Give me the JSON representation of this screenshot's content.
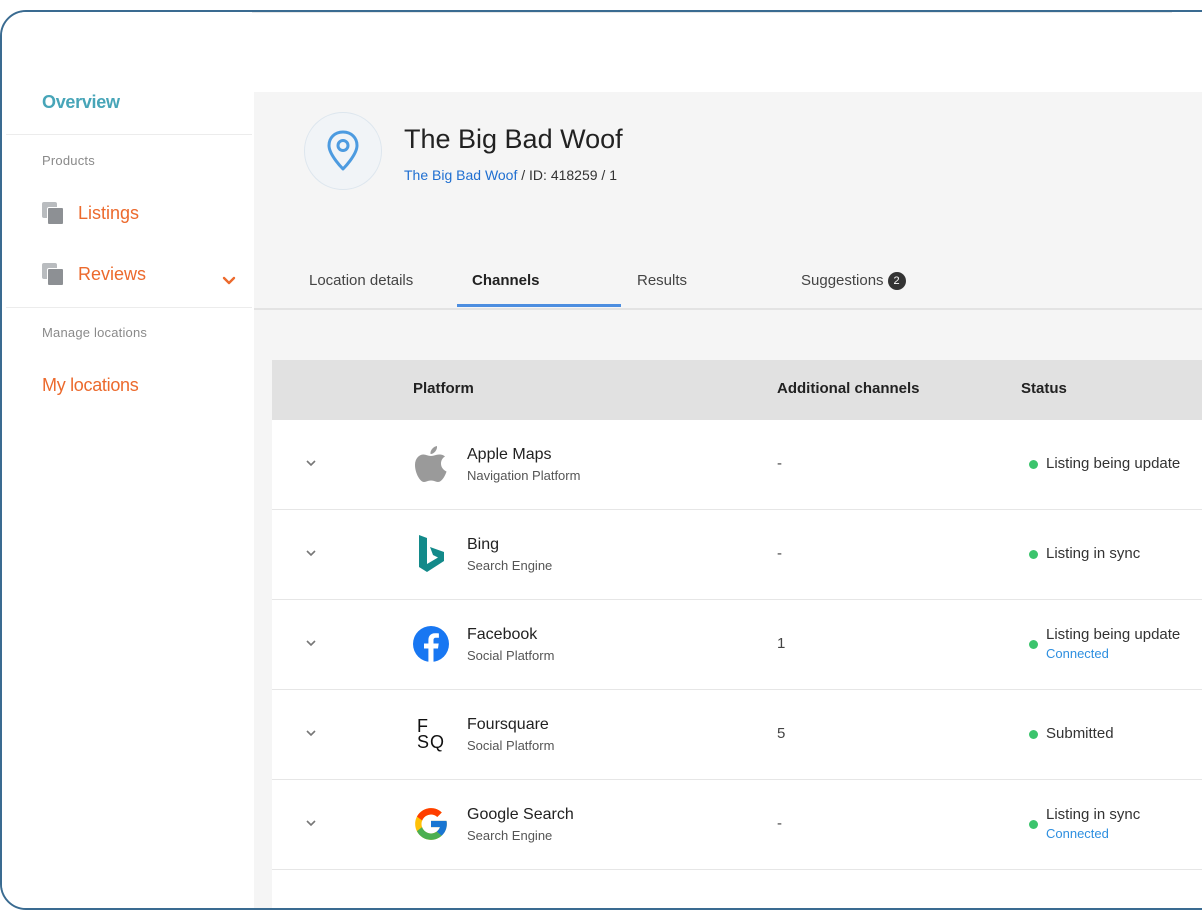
{
  "sidebar": {
    "overview": "Overview",
    "products_label": "Products",
    "listings": "Listings",
    "reviews": "Reviews",
    "manage_label": "Manage locations",
    "my_locations": "My locations"
  },
  "location": {
    "title": "The Big Bad Woof",
    "breadcrumb_link": "The Big Bad Woof",
    "breadcrumb_rest": " / ID: 418259 / 1"
  },
  "tabs": [
    {
      "label": "Location details"
    },
    {
      "label": "Channels"
    },
    {
      "label": "Results"
    },
    {
      "label": "Suggestions",
      "badge": "2"
    }
  ],
  "table": {
    "headers": [
      "Platform",
      "Additional channels",
      "Status"
    ],
    "rows": [
      {
        "name": "Apple Maps",
        "type": "Navigation Platform",
        "additional": "-",
        "status": "Listing being update",
        "sub": ""
      },
      {
        "name": "Bing",
        "type": "Search Engine",
        "additional": "-",
        "status": "Listing in sync",
        "sub": ""
      },
      {
        "name": "Facebook",
        "type": "Social Platform",
        "additional": "1",
        "status": "Listing being update",
        "sub": "Connected"
      },
      {
        "name": "Foursquare",
        "type": "Social Platform",
        "additional": "5",
        "status": "Submitted",
        "sub": ""
      },
      {
        "name": "Google Search",
        "type": "Search Engine",
        "additional": "-",
        "status": "Listing in sync",
        "sub": "Connected"
      }
    ]
  },
  "logos": {
    "foursquare_line1": "F",
    "foursquare_line2": "SQ"
  },
  "colors": {
    "accent_orange": "#ec6a2d",
    "accent_teal": "#47a5b8",
    "link_blue": "#1f6fd1",
    "status_green": "#3cc46d"
  }
}
